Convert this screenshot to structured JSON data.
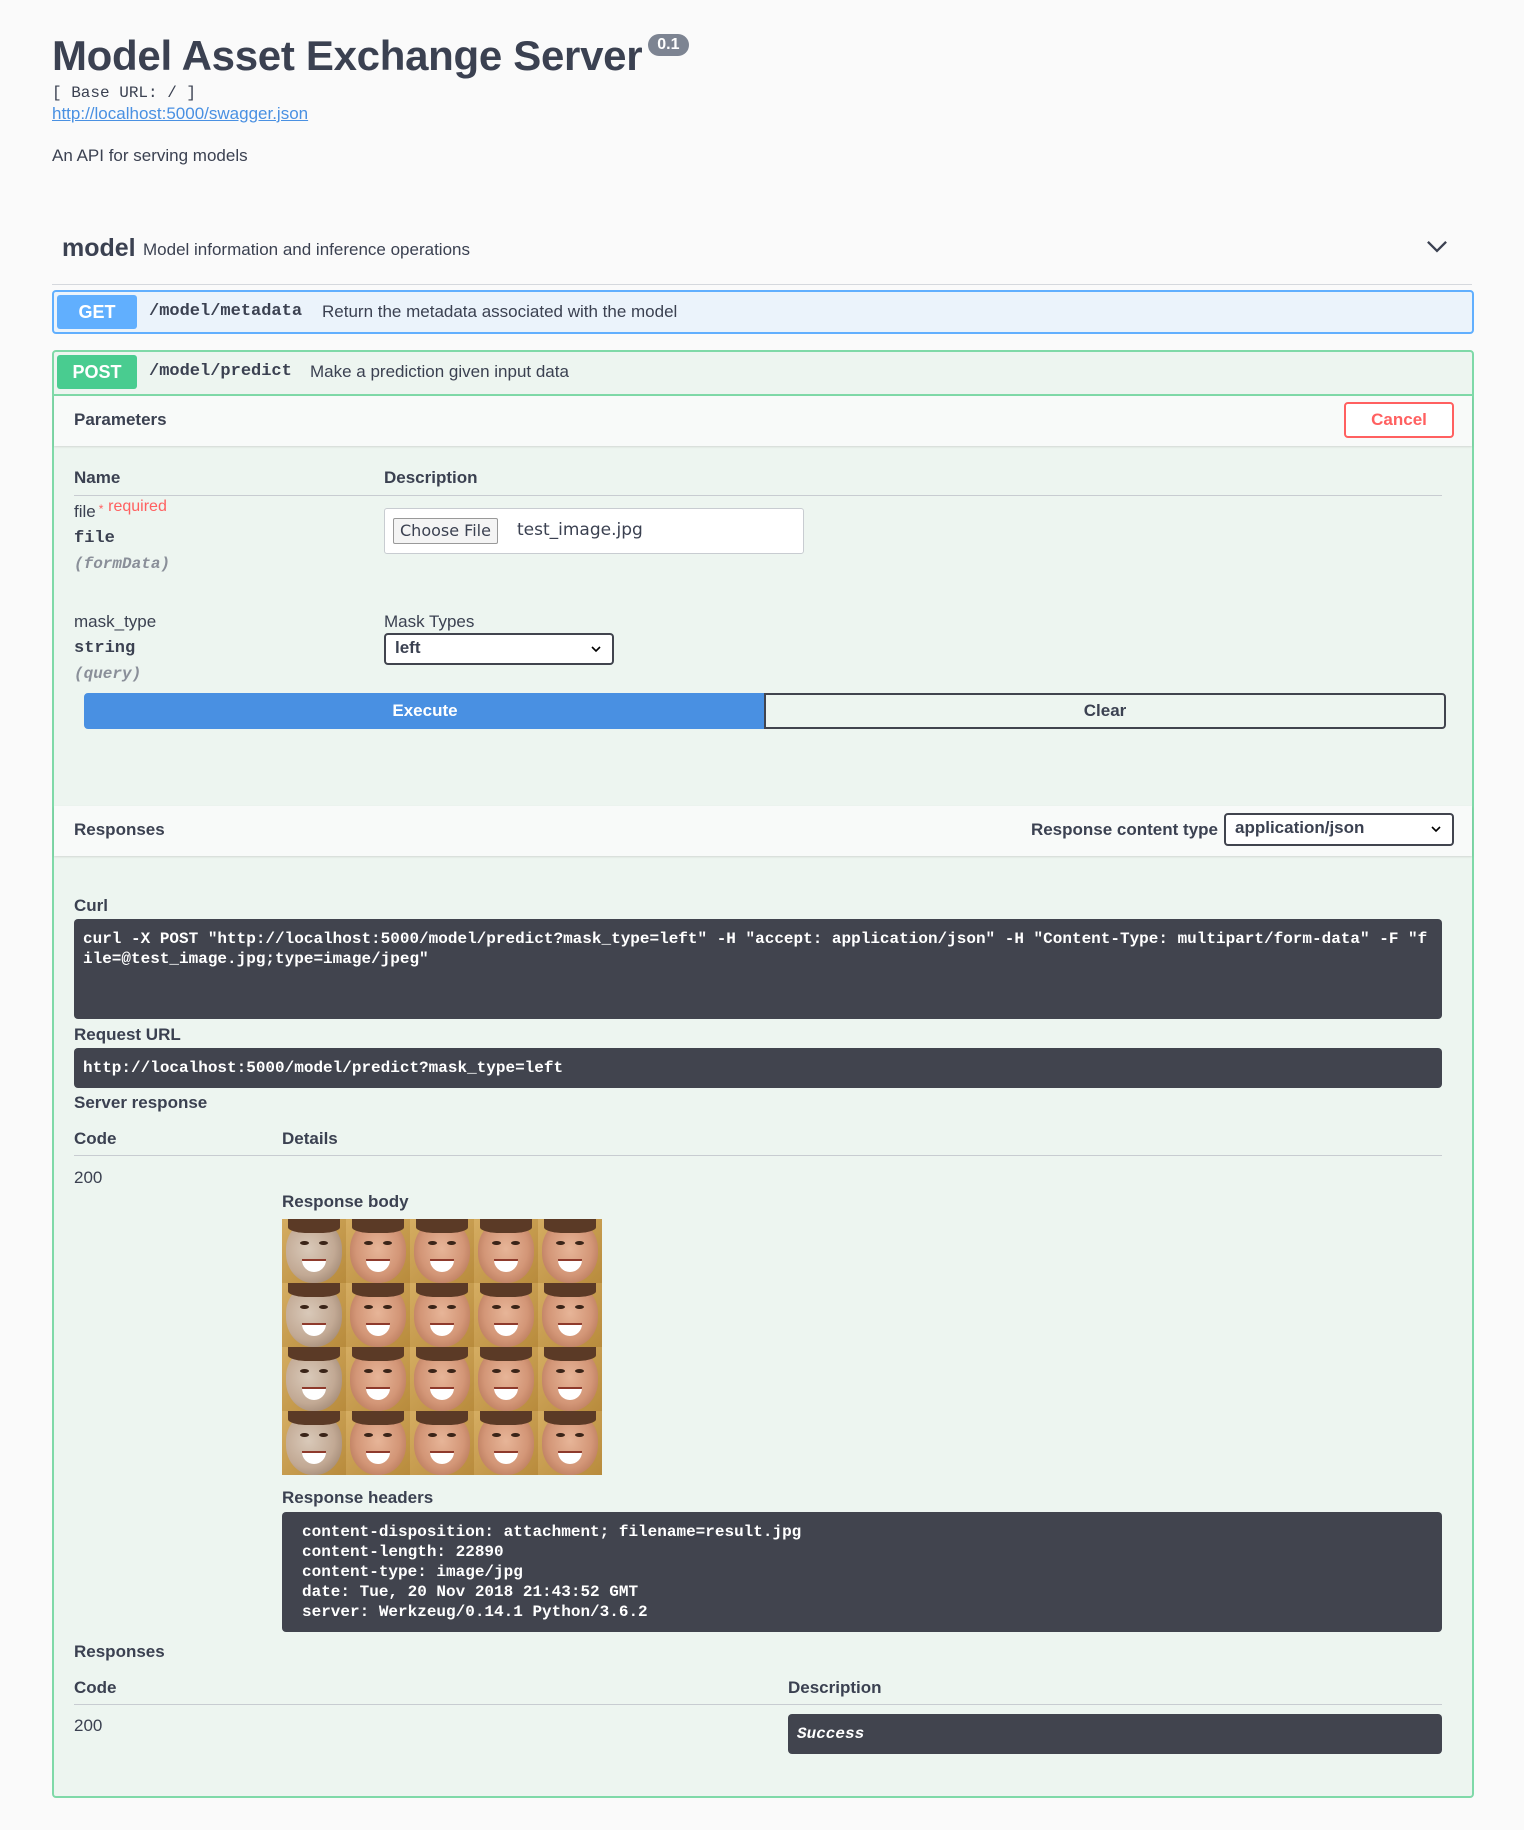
{
  "info": {
    "title": "Model Asset Exchange Server",
    "version": "0.1",
    "base_url": "[ Base URL: / ]",
    "spec_link": "http://localhost:5000/swagger.json",
    "description": "An API for serving models"
  },
  "tag": {
    "name": "model",
    "description": "Model information and inference operations",
    "toggle_icon": "chevron-down-icon"
  },
  "operations": [
    {
      "method": "GET",
      "path": "/model/metadata",
      "summary": "Return the metadata associated with the model",
      "color": "#61affe"
    },
    {
      "method": "POST",
      "path": "/model/predict",
      "summary": "Make a prediction given input data",
      "color": "#49cc90"
    }
  ],
  "params_section": {
    "title": "Parameters",
    "cancel_label": "Cancel",
    "col_name": "Name",
    "col_desc": "Description",
    "params": [
      {
        "name": "file",
        "required_mark": "*",
        "required_label": "required",
        "type": "file",
        "in": "(formData)",
        "choose_label": "Choose File",
        "file_name": "test_image.jpg"
      },
      {
        "name": "mask_type",
        "type": "string",
        "in": "(query)",
        "label": "Mask Types",
        "selected": "left"
      }
    ],
    "execute_label": "Execute",
    "clear_label": "Clear"
  },
  "responses_bar": {
    "title": "Responses",
    "content_type_label": "Response content type",
    "content_type": "application/json"
  },
  "result": {
    "curl_label": "Curl",
    "curl": "curl -X POST \"http://localhost:5000/model/predict?mask_type=left\" -H \"accept: application/json\" -H \"Content-Type: multipart/form-data\" -F \"file=@test_image.jpg;type=image/jpeg\"",
    "request_url_label": "Request URL",
    "request_url": "http://localhost:5000/model/predict?mask_type=left",
    "server_response_label": "Server response",
    "col_code": "Code",
    "col_details": "Details",
    "code": "200",
    "body_label": "Response body",
    "headers_label": "Response headers",
    "headers": "content-disposition: attachment; filename=result.jpg\ncontent-length: 22890\ncontent-type: image/jpg\ndate: Tue, 20 Nov 2018 21:43:52 GMT\nserver: Werkzeug/0.14.1 Python/3.6.2"
  },
  "responses": {
    "title": "Responses",
    "col_code": "Code",
    "col_desc": "Description",
    "rows": [
      {
        "code": "200",
        "description": "Success"
      }
    ]
  }
}
